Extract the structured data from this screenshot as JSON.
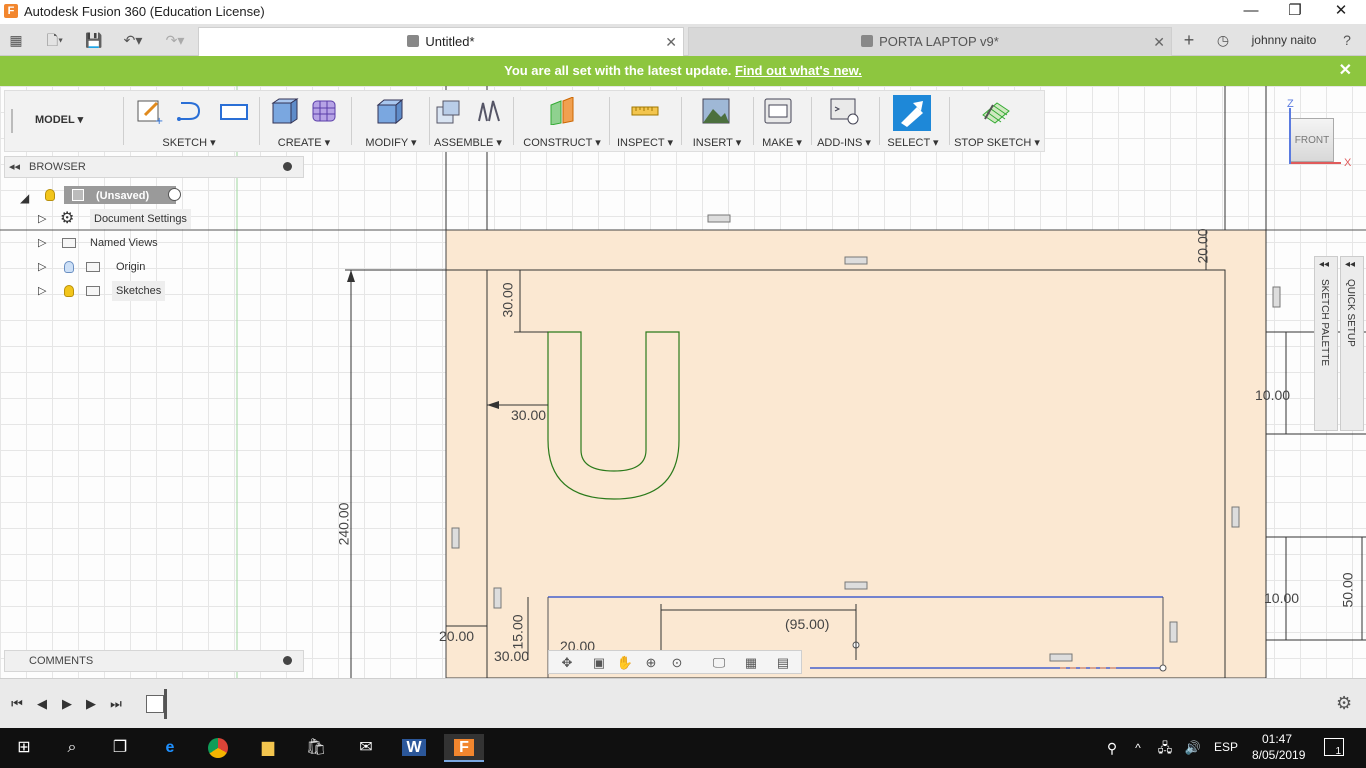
{
  "window": {
    "title": "Autodesk Fusion 360 (Education License)",
    "app_glyph": "F",
    "minimize": "—",
    "restore": "❐",
    "close": "✕"
  },
  "tabs": {
    "active": {
      "label": "Untitled*",
      "close": "✕"
    },
    "inactive": {
      "label": "PORTA LAPTOP v9*",
      "close": "✕"
    },
    "new_tab": "+",
    "user": "johnny naito",
    "help": "?"
  },
  "banner": {
    "message": "You are all set with the latest update.",
    "link": "Find out what's new.",
    "close": "✕"
  },
  "toolbar": {
    "mode": "MODEL ▾",
    "groups": [
      {
        "label": "SKETCH ▾"
      },
      {
        "label": "CREATE ▾"
      },
      {
        "label": "MODIFY ▾"
      },
      {
        "label": "ASSEMBLE ▾"
      },
      {
        "label": "CONSTRUCT ▾"
      },
      {
        "label": "INSPECT ▾"
      },
      {
        "label": "INSERT ▾"
      },
      {
        "label": "MAKE ▾"
      },
      {
        "label": "ADD-INS ▾"
      },
      {
        "label": "SELECT ▾"
      },
      {
        "label": "STOP SKETCH ▾"
      }
    ]
  },
  "browser": {
    "title": "BROWSER",
    "collapse": "◂◂",
    "root": "(Unsaved)",
    "items": [
      {
        "label": "Document Settings"
      },
      {
        "label": "Named Views"
      },
      {
        "label": "Origin"
      },
      {
        "label": "Sketches"
      }
    ]
  },
  "comments": {
    "title": "COMMENTS"
  },
  "viewcube": {
    "face": "FRONT",
    "axis_z": "Z",
    "axis_x": "X"
  },
  "palettes": {
    "sketch": "SKETCH PALETTE",
    "quick": "QUICK SETUP"
  },
  "dimensions": {
    "d20_top": "20.00",
    "d30_top": "30.00",
    "d30_left": "30.00",
    "d240": "240.00",
    "d10_a": "10.00",
    "d10_b": "10.00",
    "d50": "50.00",
    "d95": "(95.00)",
    "d20_bottom": "20.00",
    "d30_bottom": "30.00",
    "d15": "15.00",
    "d20_inner": "20.00"
  },
  "taskbar": {
    "language": "ESP",
    "time": "01:47",
    "date": "8/05/2019",
    "notifications": "1"
  },
  "colors": {
    "accent_green": "#8dc63f",
    "sketch_profile": "#fbe8d2",
    "line_green": "#2b7a1b",
    "line_blue": "#2244cc"
  }
}
